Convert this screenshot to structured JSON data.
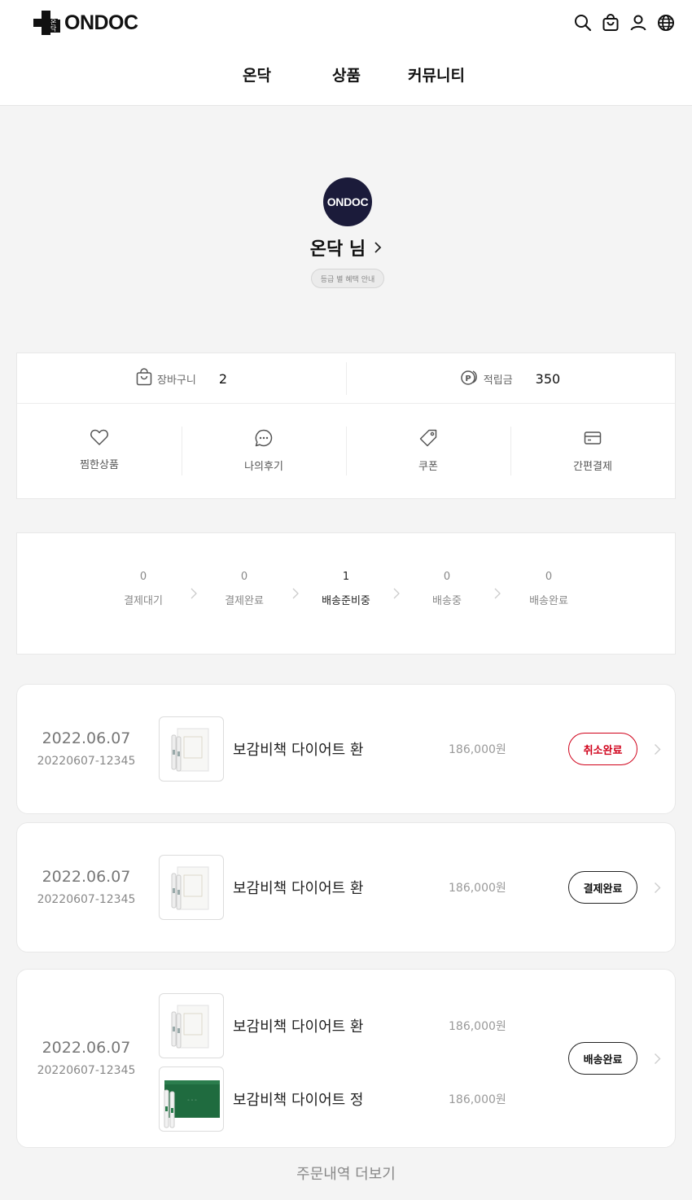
{
  "header": {
    "logo_text": "ONDOC",
    "logo_mark": "온닥",
    "icons": [
      "search-icon",
      "bag-icon",
      "user-icon",
      "globe-icon"
    ],
    "nav": [
      "온닥",
      "상품",
      "커뮤니티"
    ]
  },
  "profile": {
    "avatar_text": "ONDOC",
    "name": "온닥 님",
    "grade_button": "등급 별 혜택 안내"
  },
  "summary": {
    "cart_label": "장바구니",
    "cart_value": "2",
    "points_label": "적립금",
    "points_value": "350",
    "quick_links": [
      "찜한상품",
      "나의후기",
      "쿠폰",
      "간편결제"
    ]
  },
  "order_status": {
    "steps": [
      {
        "count": "0",
        "label": "결제대기"
      },
      {
        "count": "0",
        "label": "결제완료"
      },
      {
        "count": "1",
        "label": "배송준비중"
      },
      {
        "count": "0",
        "label": "배송중"
      },
      {
        "count": "0",
        "label": "배송완료"
      }
    ],
    "active_index": 2
  },
  "orders": [
    {
      "date": "2022.06.07",
      "order_no": "20220607-12345",
      "items": [
        {
          "name": "보감비책 다이어트 환",
          "price": "186,000원"
        }
      ],
      "status": "취소완료"
    },
    {
      "date": "2022.06.07",
      "order_no": "20220607-12345",
      "items": [
        {
          "name": "보감비책 다이어트 환",
          "price": "186,000원"
        }
      ],
      "status": "결제완료"
    },
    {
      "date": "2022.06.07",
      "order_no": "20220607-12345",
      "items": [
        {
          "name": "보감비책 다이어트 환",
          "price": "186,000원"
        },
        {
          "name": "보감비책 다이어트 정",
          "price": "186,000원"
        }
      ],
      "status": "배송완료"
    }
  ],
  "more_label": "주문내역 더보기",
  "colors": {
    "accent_red": "#d0021b",
    "avatar_bg": "#1b1b3a",
    "box_green": "#1f6b3f"
  }
}
